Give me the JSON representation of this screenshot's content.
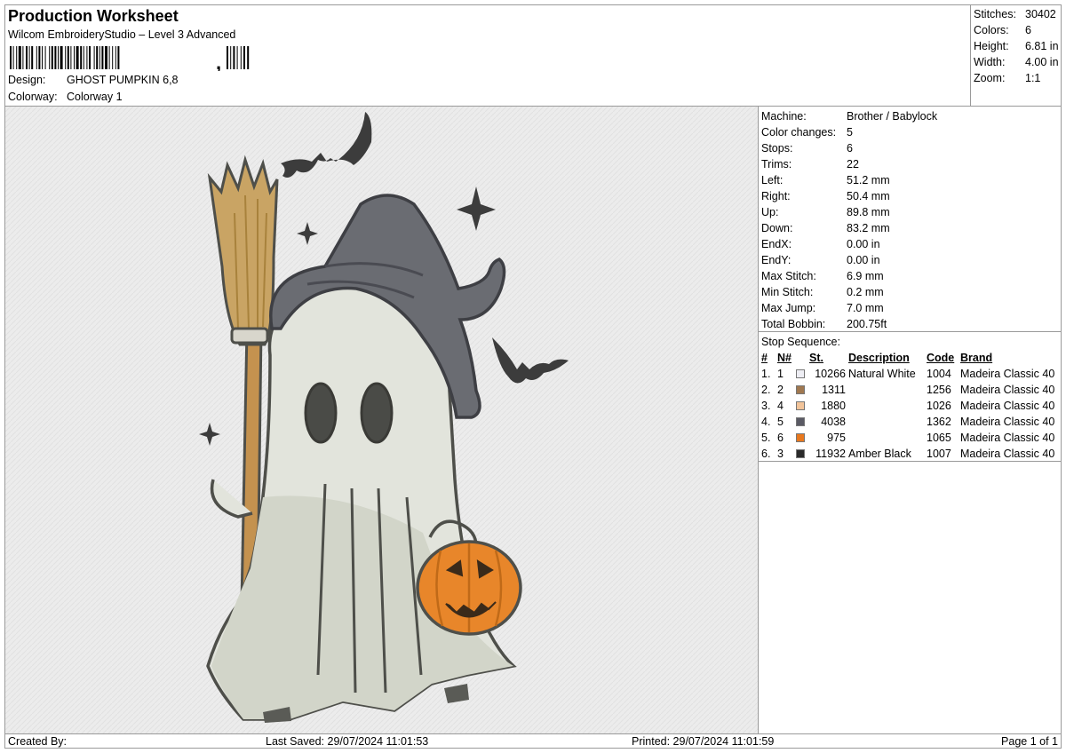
{
  "header": {
    "title": "Production Worksheet",
    "software": "Wilcom EmbroideryStudio – Level 3 Advanced",
    "barcode_suffix": ",",
    "design_label": "Design:",
    "design_value": "GHOST PUMPKIN 6,8",
    "colorway_label": "Colorway:",
    "colorway_value": "Colorway 1"
  },
  "summary": [
    {
      "label": "Stitches:",
      "value": "30402"
    },
    {
      "label": "Colors:",
      "value": "6"
    },
    {
      "label": "Height:",
      "value": "6.81 in"
    },
    {
      "label": "Width:",
      "value": "4.00 in"
    },
    {
      "label": "Zoom:",
      "value": "1:1"
    }
  ],
  "machine": [
    {
      "label": "Machine:",
      "value": "Brother / Babylock"
    },
    {
      "label": "Color changes:",
      "value": "5"
    },
    {
      "label": "Stops:",
      "value": "6"
    },
    {
      "label": "Trims:",
      "value": "22"
    },
    {
      "label": "Left:",
      "value": "51.2 mm"
    },
    {
      "label": "Right:",
      "value": "50.4 mm"
    },
    {
      "label": "Up:",
      "value": "89.8 mm"
    },
    {
      "label": "Down:",
      "value": "83.2 mm"
    },
    {
      "label": "EndX:",
      "value": "0.00 in"
    },
    {
      "label": "EndY:",
      "value": "0.00 in"
    },
    {
      "label": "Max Stitch:",
      "value": "6.9 mm"
    },
    {
      "label": "Min Stitch:",
      "value": "0.2 mm"
    },
    {
      "label": "Max Jump:",
      "value": "7.0 mm"
    },
    {
      "label": "Total Bobbin:",
      "value": "200.75ft"
    }
  ],
  "stop_sequence": {
    "title": "Stop Sequence:",
    "columns": {
      "idx": "#",
      "n": "N#",
      "st": "St.",
      "desc": "Description",
      "code": "Code",
      "brand": "Brand"
    },
    "rows": [
      {
        "idx": "1.",
        "n": "1",
        "color": "#eeeef4",
        "st": "10266",
        "desc": "Natural White",
        "code": "1004",
        "brand": "Madeira Classic 40"
      },
      {
        "idx": "2.",
        "n": "2",
        "color": "#a07850",
        "st": "1311",
        "desc": "",
        "code": "1256",
        "brand": "Madeira Classic 40"
      },
      {
        "idx": "3.",
        "n": "4",
        "color": "#f2c49a",
        "st": "1880",
        "desc": "",
        "code": "1026",
        "brand": "Madeira Classic 40"
      },
      {
        "idx": "4.",
        "n": "5",
        "color": "#5a5a64",
        "st": "4038",
        "desc": "",
        "code": "1362",
        "brand": "Madeira Classic 40"
      },
      {
        "idx": "5.",
        "n": "6",
        "color": "#e8781e",
        "st": "975",
        "desc": "",
        "code": "1065",
        "brand": "Madeira Classic 40"
      },
      {
        "idx": "6.",
        "n": "3",
        "color": "#2a2a2a",
        "st": "11932",
        "desc": "Amber Black",
        "code": "1007",
        "brand": "Madeira Classic 40"
      }
    ]
  },
  "footer": {
    "created": "Created By:",
    "saved": "Last Saved: 29/07/2024 11:01:53",
    "printed": "Printed: 29/07/2024 11:01:59",
    "page": "Page 1 of 1"
  },
  "colors": {
    "fabric": "#ececec",
    "outline": "#4e4f4a",
    "ghost": "#e2e4dc",
    "ghost_shade": "#d2d5c9",
    "hat": "#6a6c72",
    "broom_straw": "#c9a464",
    "broom_handle": "#c4924f",
    "pumpkin": "#e8862a",
    "bat": "#3c3c3c"
  }
}
